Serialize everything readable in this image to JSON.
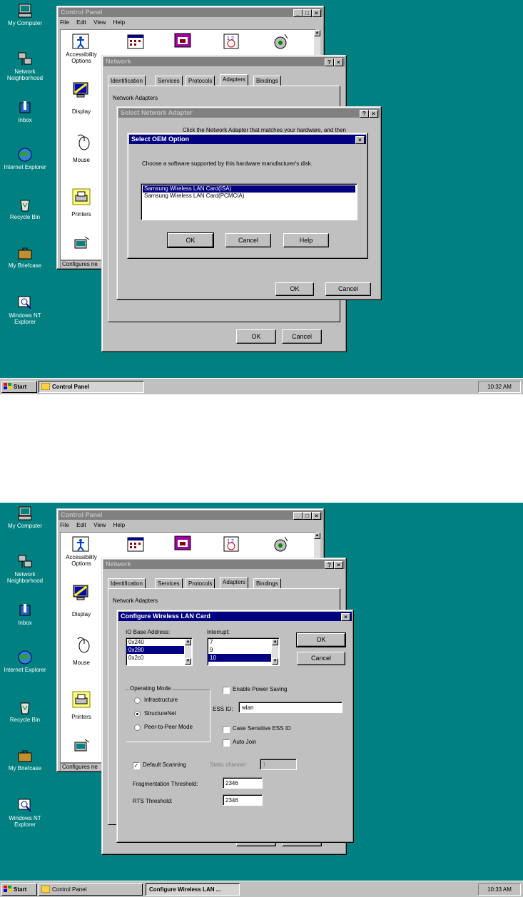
{
  "desktop_icons": [
    "My Computer",
    "Network Neighborhood",
    "Inbox",
    "Internet Explorer",
    "Recycle Bin",
    "My Briefcase",
    "Windows NT Explorer"
  ],
  "control_panel": {
    "title": "Control Panel",
    "menu": [
      "File",
      "Edit",
      "View",
      "Help"
    ],
    "items": [
      "Accessibility Options",
      "Display",
      "Mouse",
      "Printers"
    ],
    "status": "Configures ne"
  },
  "network": {
    "title": "Network",
    "tabs": [
      "Identification",
      "Services",
      "Protocols",
      "Adapters",
      "Bindings"
    ],
    "section_label": "Network Adapters",
    "ok": "OK",
    "cancel": "Cancel"
  },
  "select_adapter": {
    "title": "Select Network Adapter",
    "text": "Click the Network Adapter that matches your hardware, and then",
    "ok": "OK",
    "cancel": "Cancel"
  },
  "oem": {
    "title": "Select OEM Option",
    "prompt": "Choose a software supported by this hardware manufacturer's disk.",
    "options": [
      "Samsung Wireless LAN Card(ISA)",
      "Samsung Wireless LAN Card(PCMCIA)"
    ],
    "ok": "OK",
    "cancel": "Cancel",
    "help": "Help"
  },
  "config": {
    "title": "Configure Wireless LAN Card",
    "io_label": "IO Base Address:",
    "io_options": [
      "0x240",
      "0x280",
      "0x2c0"
    ],
    "irq_label": "Interrupt:",
    "irq_options": [
      "7",
      "9",
      "10"
    ],
    "ok": "OK",
    "cancel": "Cancel",
    "mode_label": "Operating Mode",
    "modes": [
      "Infrastructure",
      "StructureNet",
      "Peer-to-Peer Mode"
    ],
    "power_saving": "Enable Power Saving",
    "essid_label": "ESS ID:",
    "essid_value": "wlan",
    "case_sensitive": "Case Sensitive ESS ID",
    "auto_join": "Auto Join",
    "default_scanning": "Default Scanning",
    "static_channel": "Static channel",
    "static_value": "1",
    "frag_label": "Fragmentation Threshold:",
    "frag_value": "2346",
    "rts_label": "RTS Threshold:",
    "rts_value": "2346"
  },
  "taskbar_top": {
    "start": "Start",
    "item": "Control Panel",
    "clock": "10:32 AM"
  },
  "taskbar_bottom": {
    "start": "Start",
    "item1": "Control Panel",
    "item2": "Configure Wireless LAN ...",
    "clock": "10:33 AM"
  },
  "colors": {
    "desktop": "#008080",
    "title_active": "#000080",
    "title_inactive": "#808080",
    "face": "#c0c0c0"
  }
}
